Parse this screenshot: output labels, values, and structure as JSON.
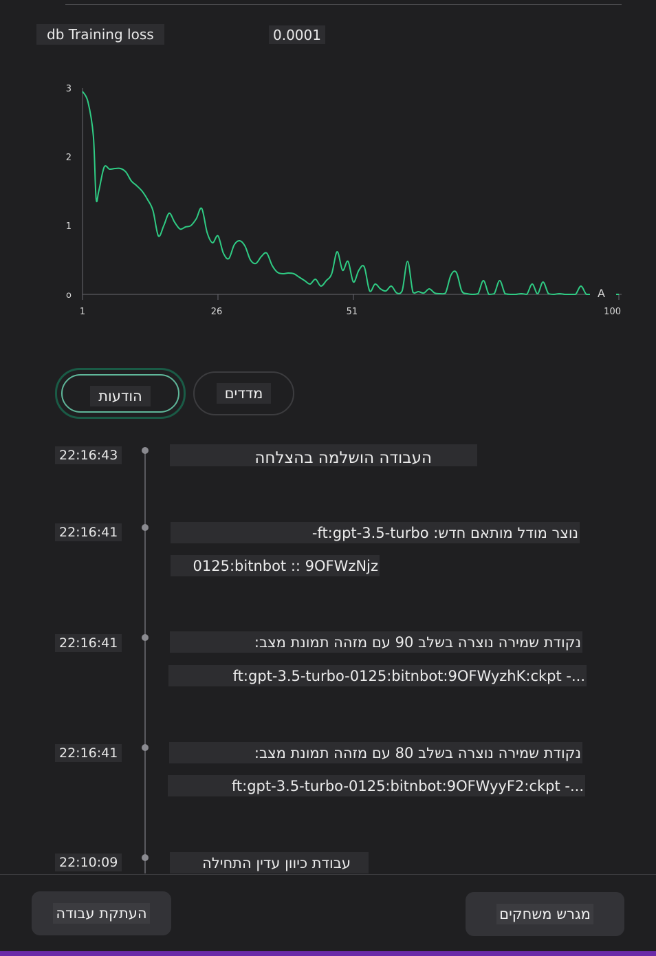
{
  "metric": {
    "name": "db Training loss",
    "value": "0.0001"
  },
  "chart_data": {
    "type": "line",
    "title": "",
    "xlabel": "",
    "ylabel": "",
    "xlim": [
      1,
      100
    ],
    "ylim": [
      0,
      3
    ],
    "x_ticks": [
      "1",
      "26",
      "51",
      "100"
    ],
    "y_ticks": [
      "3",
      "2",
      "1",
      "o"
    ],
    "end_marker": "A",
    "color": "#2fcc84",
    "series": [
      {
        "name": "",
        "points": [
          [
            1,
            2.95
          ],
          [
            2,
            2.8
          ],
          [
            3,
            2.3
          ],
          [
            3.5,
            1.4
          ],
          [
            4,
            1.5
          ],
          [
            5,
            1.85
          ],
          [
            6,
            1.82
          ],
          [
            7,
            1.83
          ],
          [
            8,
            1.83
          ],
          [
            9,
            1.78
          ],
          [
            10,
            1.65
          ],
          [
            11,
            1.58
          ],
          [
            12,
            1.5
          ],
          [
            13,
            1.38
          ],
          [
            14,
            1.22
          ],
          [
            15,
            0.85
          ],
          [
            16,
            1.0
          ],
          [
            17,
            1.18
          ],
          [
            18,
            1.05
          ],
          [
            19,
            0.95
          ],
          [
            20,
            0.98
          ],
          [
            21,
            1.0
          ],
          [
            22,
            1.1
          ],
          [
            23,
            1.25
          ],
          [
            24,
            0.9
          ],
          [
            25,
            0.75
          ],
          [
            26,
            0.85
          ],
          [
            27,
            0.6
          ],
          [
            28,
            0.52
          ],
          [
            29,
            0.72
          ],
          [
            30,
            0.78
          ],
          [
            31,
            0.7
          ],
          [
            32,
            0.5
          ],
          [
            33,
            0.45
          ],
          [
            34,
            0.55
          ],
          [
            35,
            0.6
          ],
          [
            36,
            0.42
          ],
          [
            37,
            0.32
          ],
          [
            38,
            0.3
          ],
          [
            39,
            0.31
          ],
          [
            40,
            0.3
          ],
          [
            41,
            0.25
          ],
          [
            42,
            0.2
          ],
          [
            43,
            0.15
          ],
          [
            44,
            0.22
          ],
          [
            45,
            0.12
          ],
          [
            46,
            0.2
          ],
          [
            47,
            0.3
          ],
          [
            48,
            0.62
          ],
          [
            49,
            0.35
          ],
          [
            50,
            0.48
          ],
          [
            51,
            0.18
          ],
          [
            52,
            0.35
          ],
          [
            53,
            0.4
          ],
          [
            54,
            0.05
          ],
          [
            55,
            0.15
          ],
          [
            56,
            0.08
          ],
          [
            57,
            0.05
          ],
          [
            58,
            0.12
          ],
          [
            59,
            0.02
          ],
          [
            60,
            0.05
          ],
          [
            61,
            0.48
          ],
          [
            62,
            0.03
          ],
          [
            63,
            0.04
          ],
          [
            64,
            0.02
          ],
          [
            65,
            0.08
          ],
          [
            66,
            0.02
          ],
          [
            67,
            0.01
          ],
          [
            68,
            0.02
          ],
          [
            69,
            0.28
          ],
          [
            70,
            0.32
          ],
          [
            71,
            0.05
          ],
          [
            72,
            0.01
          ],
          [
            73,
            0.0
          ],
          [
            74,
            0.01
          ],
          [
            75,
            0.2
          ],
          [
            76,
            0.0
          ],
          [
            77,
            0.01
          ],
          [
            78,
            0.2
          ],
          [
            79,
            0.01
          ],
          [
            80,
            0.0
          ],
          [
            81,
            0.0
          ],
          [
            82,
            0.01
          ],
          [
            83,
            0.0
          ],
          [
            84,
            0.15
          ],
          [
            85,
            0.01
          ],
          [
            86,
            0.18
          ],
          [
            87,
            0.01
          ],
          [
            88,
            0.0
          ],
          [
            89,
            0.01
          ],
          [
            90,
            0.0
          ],
          [
            91,
            0.0
          ],
          [
            92,
            0.0
          ],
          [
            93,
            0.12
          ],
          [
            94,
            0.0
          ],
          [
            95,
            0.0
          ],
          [
            96,
            0.05
          ],
          [
            97,
            0.0
          ],
          [
            98,
            0.0
          ],
          [
            99,
            0.0
          ],
          [
            100,
            0.0
          ]
        ]
      }
    ]
  },
  "tabs": {
    "messages_label": "הודעות",
    "metrics_label": "מדדים"
  },
  "events": [
    {
      "time": "22:16:43",
      "lines": [
        "העבודה הושלמה בהצלחה"
      ]
    },
    {
      "time": "22:16:41",
      "lines": [
        "נוצר מודל מותאם חדש: ft:gpt-3.5-turbo-",
        "0125:bitnbot :: 9OFWzNjz"
      ]
    },
    {
      "time": "22:16:41",
      "lines": [
        "נקודת שמירה נוצרה בשלב 90 עם מזהה תמונת מצב:",
        "ft:gpt-3.5-turbo-0125:bitnbot:9OFWyzhK:ckpt -..."
      ]
    },
    {
      "time": "22:16:41",
      "lines": [
        "נקודת שמירה נוצרה בשלב 80 עם מזהה תמונת מצב:",
        "ft:gpt-3.5-turbo-0125:bitnbot:9OFWyyF2:ckpt -..."
      ]
    },
    {
      "time": "22:10:09",
      "lines": [
        "עבודת כיוון עדין התחילה"
      ]
    }
  ],
  "footer": {
    "copy_job_label": "העתקת עבודה",
    "playground_label": "מגרש משחקים"
  }
}
